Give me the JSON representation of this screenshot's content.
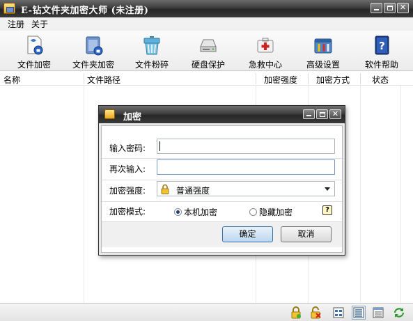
{
  "window": {
    "title": "E-钻文件夹加密大师 (未注册)"
  },
  "menu": {
    "items": [
      {
        "label": "注册"
      },
      {
        "label": "关于"
      }
    ]
  },
  "toolbar": {
    "buttons": [
      {
        "label": "文件加密",
        "icon": "file-encrypt-icon"
      },
      {
        "label": "文件夹加密",
        "icon": "folder-encrypt-icon"
      },
      {
        "label": "文件粉碎",
        "icon": "shredder-icon"
      },
      {
        "label": "硬盘保护",
        "icon": "hard-disk-icon"
      },
      {
        "label": "急救中心",
        "icon": "first-aid-icon"
      },
      {
        "label": "高级设置",
        "icon": "settings-tools-icon"
      },
      {
        "label": "软件帮助",
        "icon": "help-book-icon"
      }
    ]
  },
  "list": {
    "columns": [
      "名称",
      "文件路径",
      "加密强度",
      "加密方式",
      "状态"
    ],
    "rows": []
  },
  "dialog": {
    "title": "加密",
    "password_label": "输入密码:",
    "password_value": "",
    "confirm_label": "再次输入:",
    "confirm_value": "",
    "strength_label": "加密强度:",
    "strength_value": "普通强度",
    "mode_label": "加密模式:",
    "mode_options": [
      {
        "label": "本机加密",
        "selected": true
      },
      {
        "label": "隐藏加密",
        "selected": false
      }
    ],
    "help_glyph": "?",
    "ok_label": "确定",
    "cancel_label": "取消"
  },
  "colors": {
    "titlebar": "#2c2c2c",
    "ok_button_border": "#3a6ea5"
  }
}
